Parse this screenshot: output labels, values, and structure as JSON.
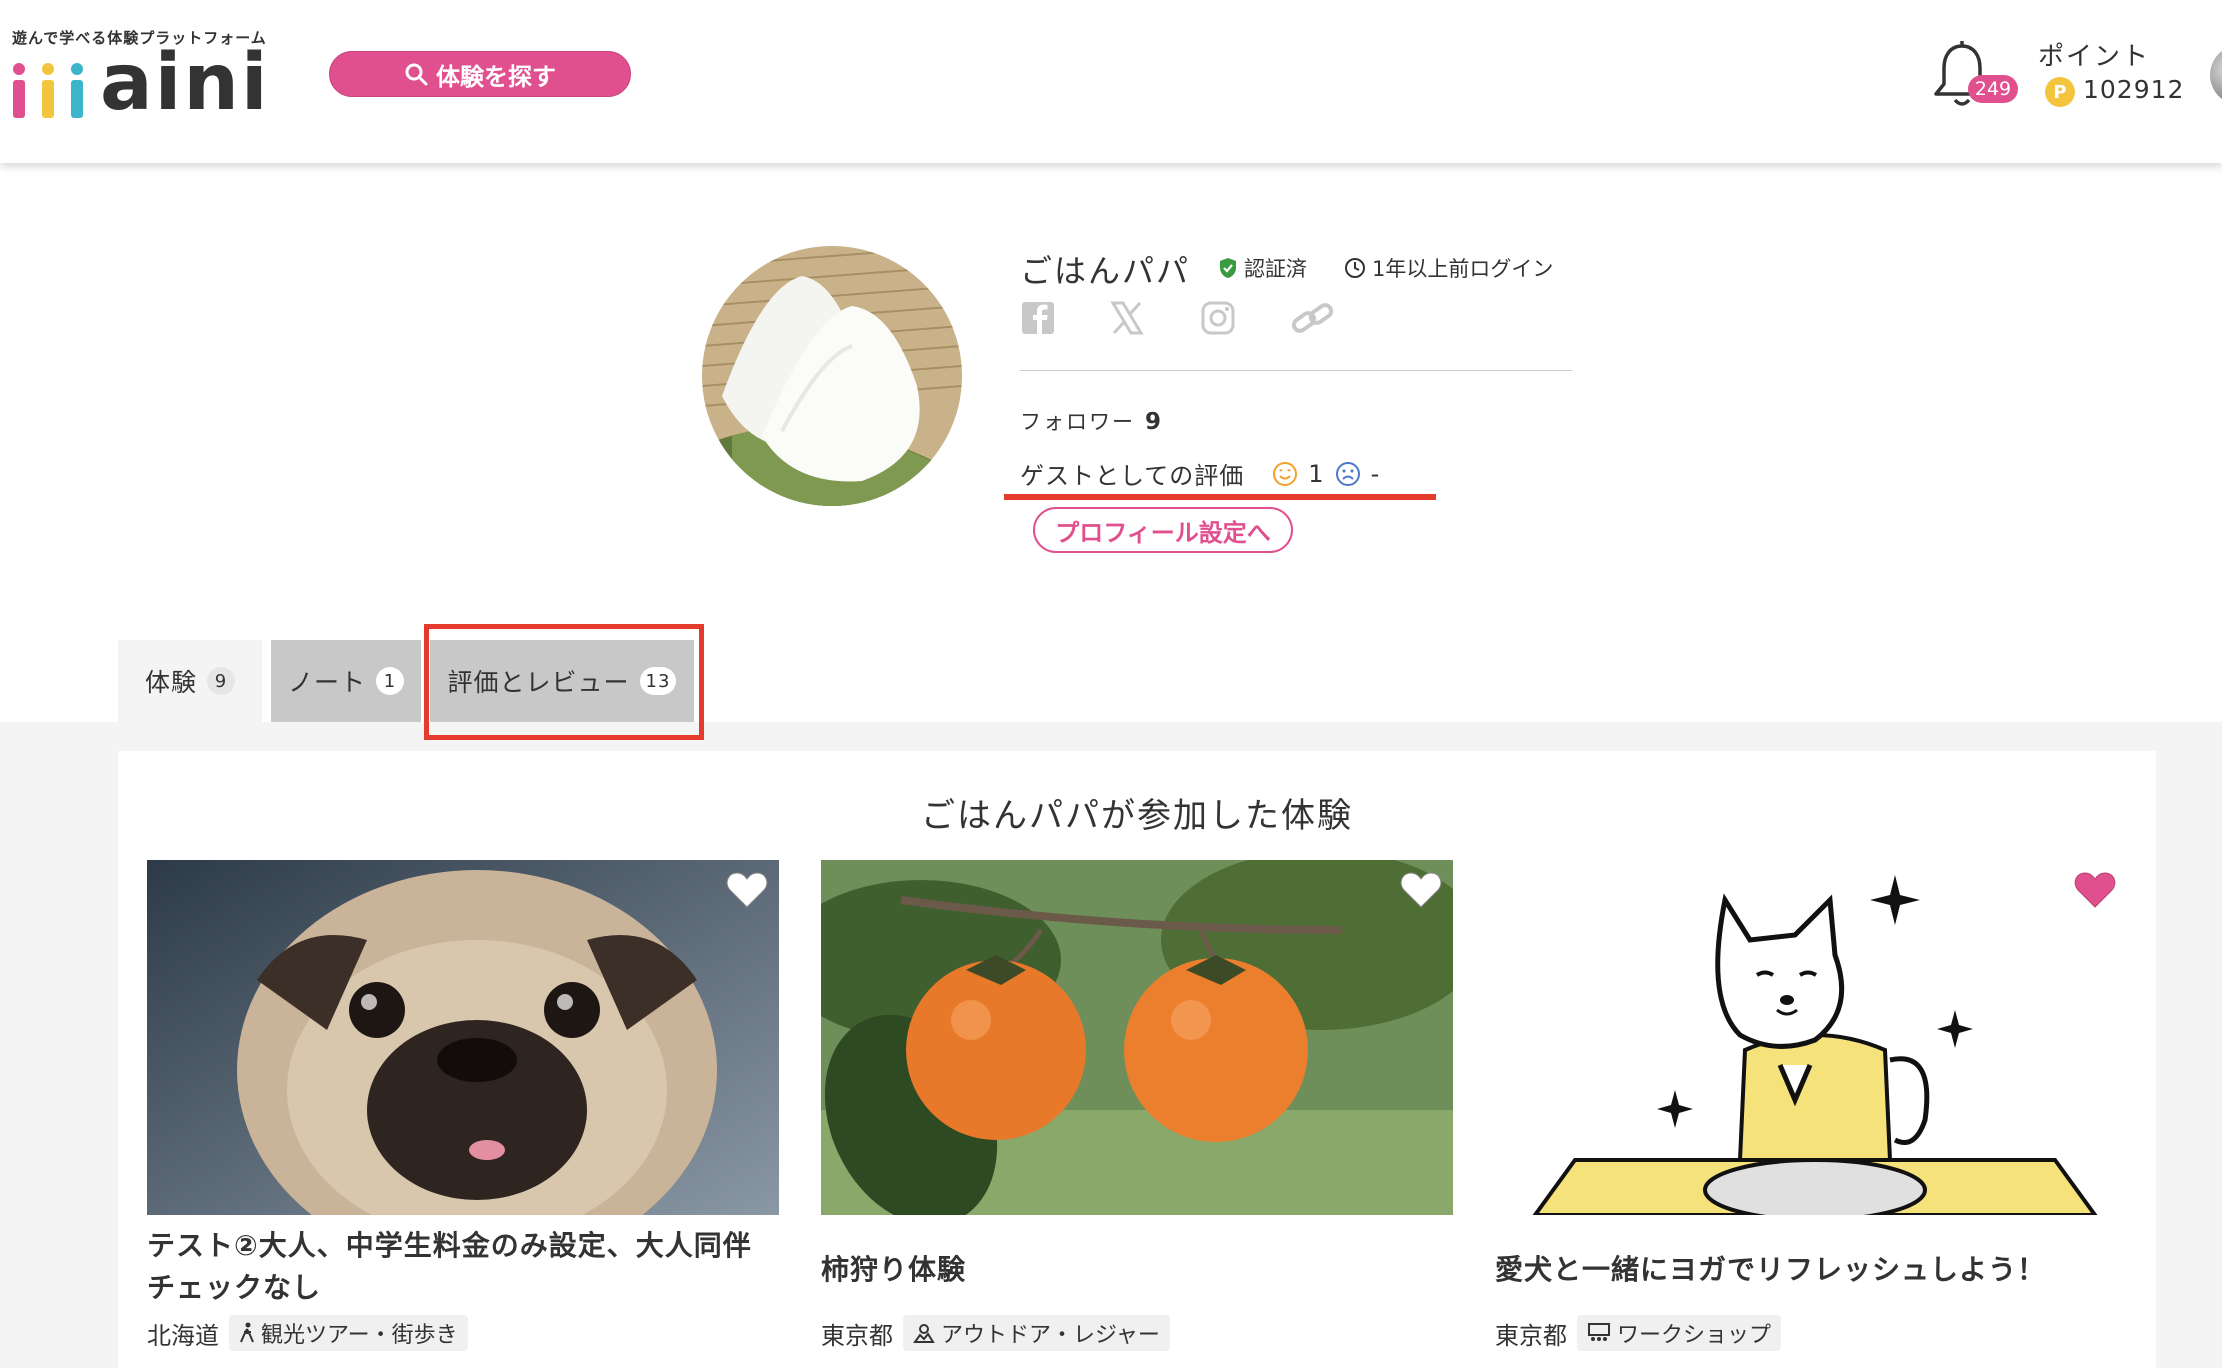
{
  "header": {
    "tagline": "遊んで学べる体験プラットフォーム",
    "logo_text": "aini",
    "search_label": "体験を探す",
    "notification_count": "249",
    "points_label": "ポイント",
    "points_coin": "P",
    "points_value": "102912"
  },
  "profile": {
    "name": "ごはんパパ",
    "verified_label": "認証済",
    "last_login": "1年以上前ログイン",
    "follower_label": "フォロワー",
    "follower_count": "9",
    "guest_eval_label": "ゲストとしての評価",
    "good_count": "1",
    "bad_count": "-",
    "settings_button": "プロフィール設定へ"
  },
  "tabs": [
    {
      "label": "体験",
      "count": "9"
    },
    {
      "label": "ノート",
      "count": "1"
    },
    {
      "label": "評価とレビュー",
      "count": "13"
    }
  ],
  "section_title": "ごはんパパが参加した体験",
  "cards": [
    {
      "title": "テスト②大人、中学生料金のみ設定、大人同伴チェックなし",
      "region": "北海道",
      "category": "観光ツアー・街歩き",
      "favorited": false
    },
    {
      "title": "柿狩り体験",
      "region": "東京都",
      "category": "アウトドア・レジャー",
      "favorited": false
    },
    {
      "title": "愛犬と一緒にヨガでリフレッシュしよう！",
      "region": "東京都",
      "category": "ワークショップ",
      "favorited": true
    }
  ],
  "colors": {
    "brand_pink": "#e0508f",
    "highlight_red": "#e53b2c",
    "coin_yellow": "#f3c53f"
  }
}
